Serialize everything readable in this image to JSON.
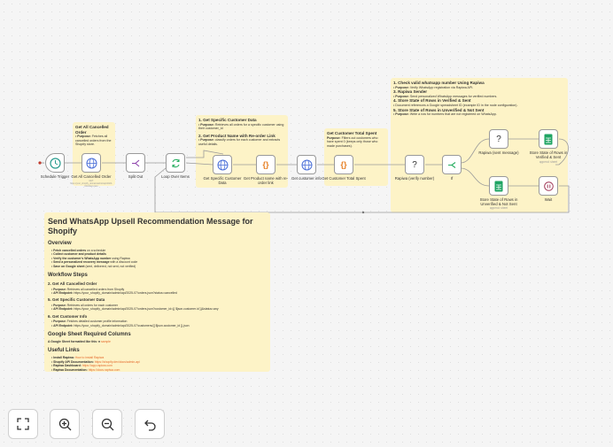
{
  "nodes": {
    "schedule_trigger": {
      "label": "Schedule Trigger",
      "icon": "clock-icon"
    },
    "get_cancelled": {
      "label": "Get All Cancelled Order",
      "sub": "GET: https://your_shopify_domain/admin/api/2024-01/orders.json"
    },
    "split_out": {
      "label": "Split Out",
      "icon": "split-icon"
    },
    "loop_over_items": {
      "label": "Loop Over Items",
      "icon": "loop-icon"
    },
    "get_customer_data": {
      "label": "Get Specific Customer Data"
    },
    "get_product_name": {
      "label": "Get Product name with re-order link"
    },
    "get_customer_info": {
      "label": "Get customer info"
    },
    "get_customer_total_spent": {
      "label": "Get Customer Total Spent"
    },
    "rapiwa_verify": {
      "label": "Rapiwa (verify number)",
      "glyph": "?"
    },
    "if_node": {
      "label": "If"
    },
    "rapiwa_send": {
      "label": "Rapiwa (sent message)",
      "glyph": "?"
    },
    "store_verified": {
      "label": "Store State of Rows in Verified & Sent",
      "sub": "append: sheet"
    },
    "store_unverified": {
      "label": "Store State of Rows in Unverified & Not Sent",
      "sub": "append: sheet"
    },
    "wait": {
      "label": "Wait"
    }
  },
  "stickies": {
    "cancelled": {
      "title": "Get All Cancelled Order",
      "items": [
        {
          "bold": "Purpose:",
          "text": "Fetches all cancelled orders from the Shopify store."
        }
      ]
    },
    "customer": {
      "title1": "1. Get Specific Customer Data",
      "item1": {
        "bold": "Purpose:",
        "text": "Retrieves all orders for a specific customer using their customer_id"
      },
      "title2": "2. Get Product Name with Re-order Link",
      "item2": {
        "bold": "Purpose:",
        "text": "classify orders for each customer and extracts useful details."
      }
    },
    "spent": {
      "title": "Get Customer Total Spent",
      "items": [
        {
          "bold": "Purpose:",
          "text": "Filters out customers who have spent 0 (keeps only those who made purchases)."
        }
      ]
    },
    "rapiwa": {
      "title1": "1. Check valid whatsapp number Using Rapiwa",
      "item1": {
        "bold": "Purpose:",
        "text": "Verify WhatsApp registration via Rapiwa API."
      },
      "title2": "3. Rapiwa Sender",
      "item2": {
        "bold": "Purpose:",
        "text": "Send personalized WhatsApp messages for verified numbers."
      },
      "title3": "4. Store State of Rows in Verified & Sent",
      "item3": {
        "bold": "",
        "text": "Document references a Google spreadsheet ID (example ID in the node configuration)."
      },
      "title4": "5. Store State of Rows in Unverified & Not Sent",
      "item4": {
        "bold": "Purpose:",
        "text": "Write a row for numbers that are not registered on WhatsApp."
      }
    }
  },
  "doc": {
    "title": "Send WhatsApp Upsell Recommendation Message for Shopify",
    "overview_h": "Overview",
    "overview": [
      {
        "bold": "Fetch cancelled orders",
        "text": " on a schedule"
      },
      {
        "bold": "Collect customer and product details",
        "text": ""
      },
      {
        "bold": "Verify the customer's WhatsApp number",
        "text": " using Rapiwa"
      },
      {
        "bold": "Send a personalized recovery message",
        "text": " with a discount code"
      },
      {
        "bold": "Save on Google sheet",
        "text": " (sent, delivered, not sent, not verified)"
      }
    ],
    "steps_h": "Workflow Steps",
    "s1_h": "2. Get All Cancelled Order",
    "s1": [
      {
        "bold": "Purpose:",
        "text": " Retrieves all cancelled orders from Shopify"
      },
      {
        "bold": "API Endpoint:",
        "text": " https://your_shopify_domain/admin/api/2025-07/orders.json?status=cancelled"
      }
    ],
    "s2_h": "5. Get Specific Customer Data",
    "s2": [
      {
        "bold": "Purpose:",
        "text": " Retrieves all orders for each customer"
      },
      {
        "bold": "API Endpoint:",
        "text": " https://your_shopify_domain/admin/api/2025-07/orders.json?customer_id={{ $json.customer.id }}&status=any"
      }
    ],
    "s3_h": "6. Get Customer Info",
    "s3": [
      {
        "bold": "Purpose:",
        "text": " Fetches detailed customer profile information"
      },
      {
        "bold": "API Endpoint:",
        "text": " https://your_shopify_domain/admin/api/2025-07/customers/{{ $json.customer_id }}.json"
      }
    ],
    "sheet_h": "Google Sheet Required Columns",
    "sheet": {
      "bold": "A Google Sheet formatted like this ➜",
      "link": " sample"
    },
    "links_h": "Useful Links",
    "links": [
      {
        "bold": "Install Rapiwa:",
        "link": " How to install Rapiwa"
      },
      {
        "bold": "Shopify API Documentation:",
        "link": " https://shopify.dev/docs/admin-api"
      },
      {
        "bold": "Rapiwa Dashboard:",
        "link": " https://app.rapiwa.com"
      },
      {
        "bold": "Rapiwa Documentation:",
        "link": " https://docs.rapiwa.com"
      }
    ]
  },
  "controls": [
    {
      "name": "fit-view-button",
      "icon": "fullscreen-icon"
    },
    {
      "name": "zoom-in-button",
      "icon": "zoom-in-icon"
    },
    {
      "name": "zoom-out-button",
      "icon": "zoom-out-icon"
    },
    {
      "name": "undo-button",
      "icon": "undo-icon"
    }
  ],
  "colors": {
    "accent": "#e46a2c",
    "sticky": "#fdf3c7",
    "globe": "#4a6fd8",
    "sheets": "#1fa463",
    "wait": "#a23a5a"
  }
}
